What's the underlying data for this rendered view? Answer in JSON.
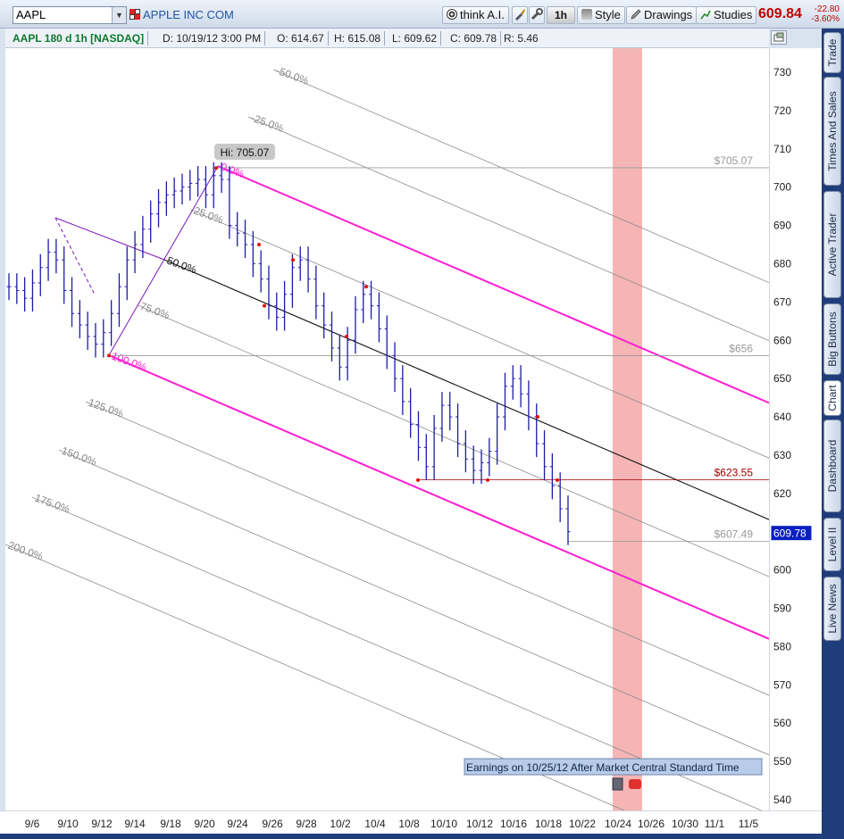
{
  "toolbar": {
    "symbol": "AAPL",
    "company": "APPLE INC COM",
    "think_ai": "think A.I.",
    "timeframe": "1h",
    "style": "Style",
    "drawings": "Drawings",
    "studies": "Studies",
    "last_price": "609.84",
    "change": "-22.80",
    "change_pct": "-3.60%"
  },
  "info": {
    "title": "AAPL 180 d 1h [NASDAQ]",
    "date": "D: 10/19/12 3:00 PM",
    "open": "O: 614.67",
    "high": "H: 615.08",
    "low": "L: 609.62",
    "close": "C: 609.78",
    "range": "R: 5.46"
  },
  "side_tabs": [
    "Trade",
    "Times And Sales",
    "Active Trader",
    "Big Buttons",
    "Chart",
    "Dashboard",
    "Level II",
    "Live News"
  ],
  "colors": {
    "candle": "#1c1ca8",
    "pitchfork_median": "#7a1ab8",
    "channel_magenta": "#ff1fd2",
    "fib_gray": "#8c8c8c",
    "earnings_band": "#f4a8a8",
    "price_red": "#c00000",
    "current_price_bg": "#0a1fc0"
  },
  "chart_data": {
    "type": "candlestick",
    "y_ticks": [
      540,
      550,
      560,
      570,
      580,
      590,
      600,
      610,
      620,
      630,
      640,
      650,
      660,
      670,
      680,
      690,
      700,
      710,
      720,
      730
    ],
    "x_ticks": [
      "9/6",
      "9/10",
      "9/12",
      "9/14",
      "9/18",
      "9/20",
      "9/24",
      "9/26",
      "9/28",
      "10/2",
      "10/4",
      "10/8",
      "10/10",
      "10/12",
      "10/16",
      "10/18",
      "10/22",
      "10/24",
      "10/26",
      "10/30",
      "11/1",
      "11/5"
    ],
    "price_levels": [
      {
        "label": "$705.07",
        "value": 705.07,
        "color": "gray"
      },
      {
        "label": "$656",
        "value": 656,
        "color": "gray"
      },
      {
        "label": "$623.55",
        "value": 623.55,
        "color": "red"
      },
      {
        "label": "$607.49",
        "value": 607.49,
        "color": "gray"
      }
    ],
    "high_label": "Hi: 705.07",
    "current_price": "609.78",
    "fib_labels": [
      "-50.0%",
      "-25.0%",
      "0.0%",
      "25.0%",
      "50.0%",
      "75.0%",
      "100.0%",
      "125.0%",
      "150.0%",
      "175.0%",
      "200.0%"
    ],
    "earnings_note": "Earnings on 10/25/12 After Market Central Standard Time",
    "close_series": [
      674,
      673,
      671,
      675,
      679,
      683,
      681,
      673,
      667,
      664,
      661,
      659,
      662,
      667,
      674,
      681,
      685,
      689,
      693,
      696,
      698,
      699,
      700,
      701,
      702,
      698,
      703,
      702,
      690,
      688,
      685,
      680,
      676,
      669,
      666,
      672,
      679,
      681,
      676,
      669,
      664,
      658,
      653,
      660,
      668,
      672,
      669,
      663,
      656,
      650,
      644,
      638,
      632,
      627,
      637,
      643,
      640,
      633,
      629,
      626,
      628,
      631,
      640,
      648,
      650,
      646,
      640,
      633,
      627,
      622,
      616,
      610
    ]
  }
}
